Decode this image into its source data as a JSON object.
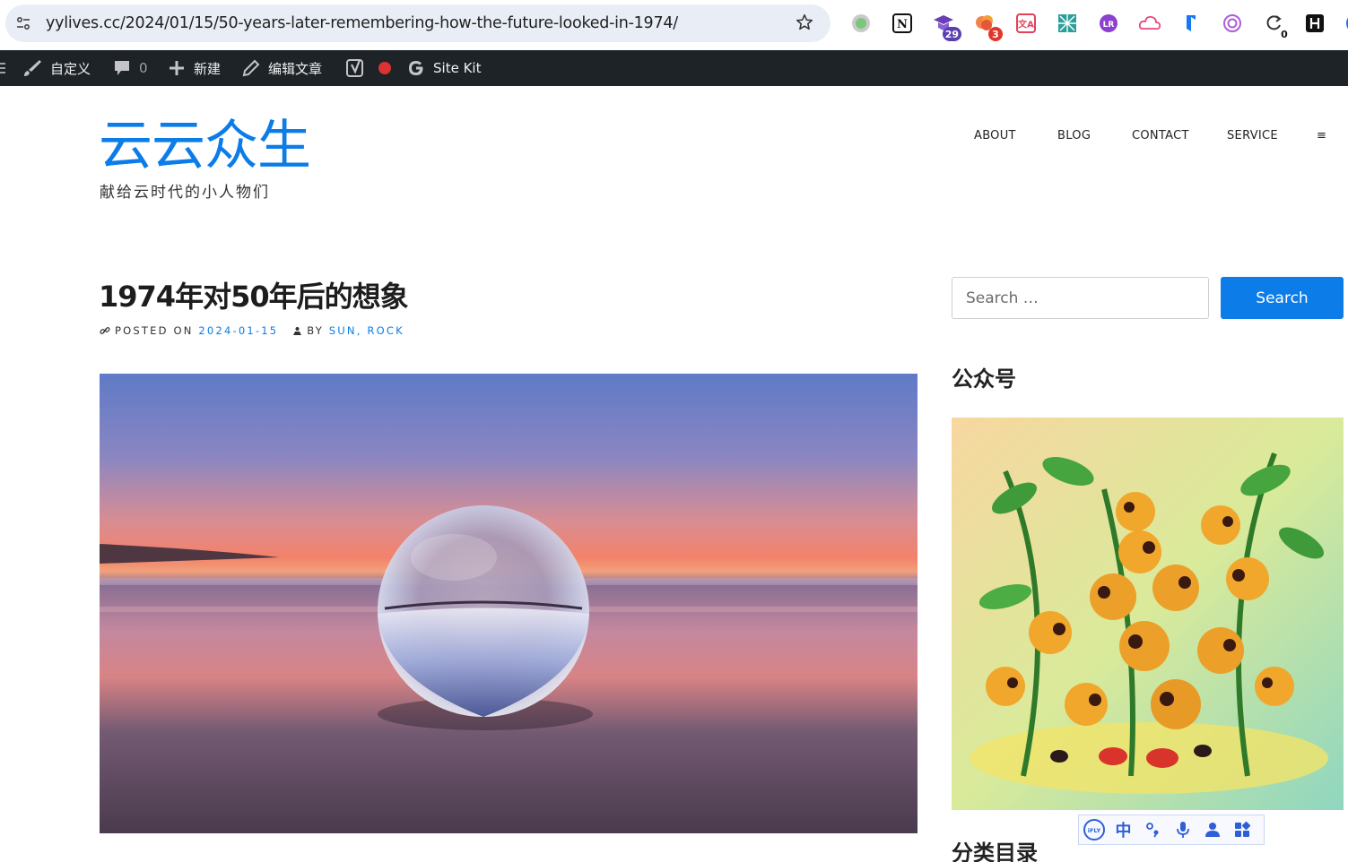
{
  "browser": {
    "url": "yylives.cc/2024/01/15/50-years-later-remembering-how-the-future-looked-in-1974/",
    "extensions": [
      {
        "icon": "circle-extension-icon"
      },
      {
        "icon": "notion-icon",
        "label": "N"
      },
      {
        "icon": "graduation-cap-icon",
        "badge": "29"
      },
      {
        "icon": "cloud-extension-icon",
        "badge": "3"
      },
      {
        "icon": "translate-icon",
        "label": "文A"
      },
      {
        "icon": "pattern-icon"
      },
      {
        "icon": "logo-lr-icon",
        "label": "LR"
      },
      {
        "icon": "cloud-outline-icon"
      },
      {
        "icon": "bookmark-arrow-icon"
      },
      {
        "icon": "openai-icon"
      },
      {
        "icon": "refresh-counter-icon",
        "badge": "0"
      },
      {
        "icon": "h-box-icon"
      },
      {
        "icon": "partial-circle-icon"
      }
    ]
  },
  "admin_bar": {
    "customize": "自定义",
    "comments_count": "0",
    "new": "新建",
    "edit_post": "编辑文章",
    "site_kit": "Site Kit"
  },
  "site": {
    "title": "云云众生",
    "description": "献给云时代的小人物们"
  },
  "nav": {
    "items": [
      "ABOUT",
      "BLOG",
      "CONTACT",
      "SERVICE",
      "≡"
    ]
  },
  "post": {
    "title": "1974年对50年后的想象",
    "posted_on_label": "POSTED ON",
    "date": "2024-01-15",
    "by_label": "BY",
    "author": "SUN, ROCK"
  },
  "sidebar": {
    "search_placeholder": "Search …",
    "search_button": "Search",
    "wechat_title": "公众号",
    "categories_title": "分类目录"
  },
  "ime": {
    "lang": "中"
  },
  "colors": {
    "accent": "#0b7ce8",
    "admin_bar": "#1d2327"
  }
}
